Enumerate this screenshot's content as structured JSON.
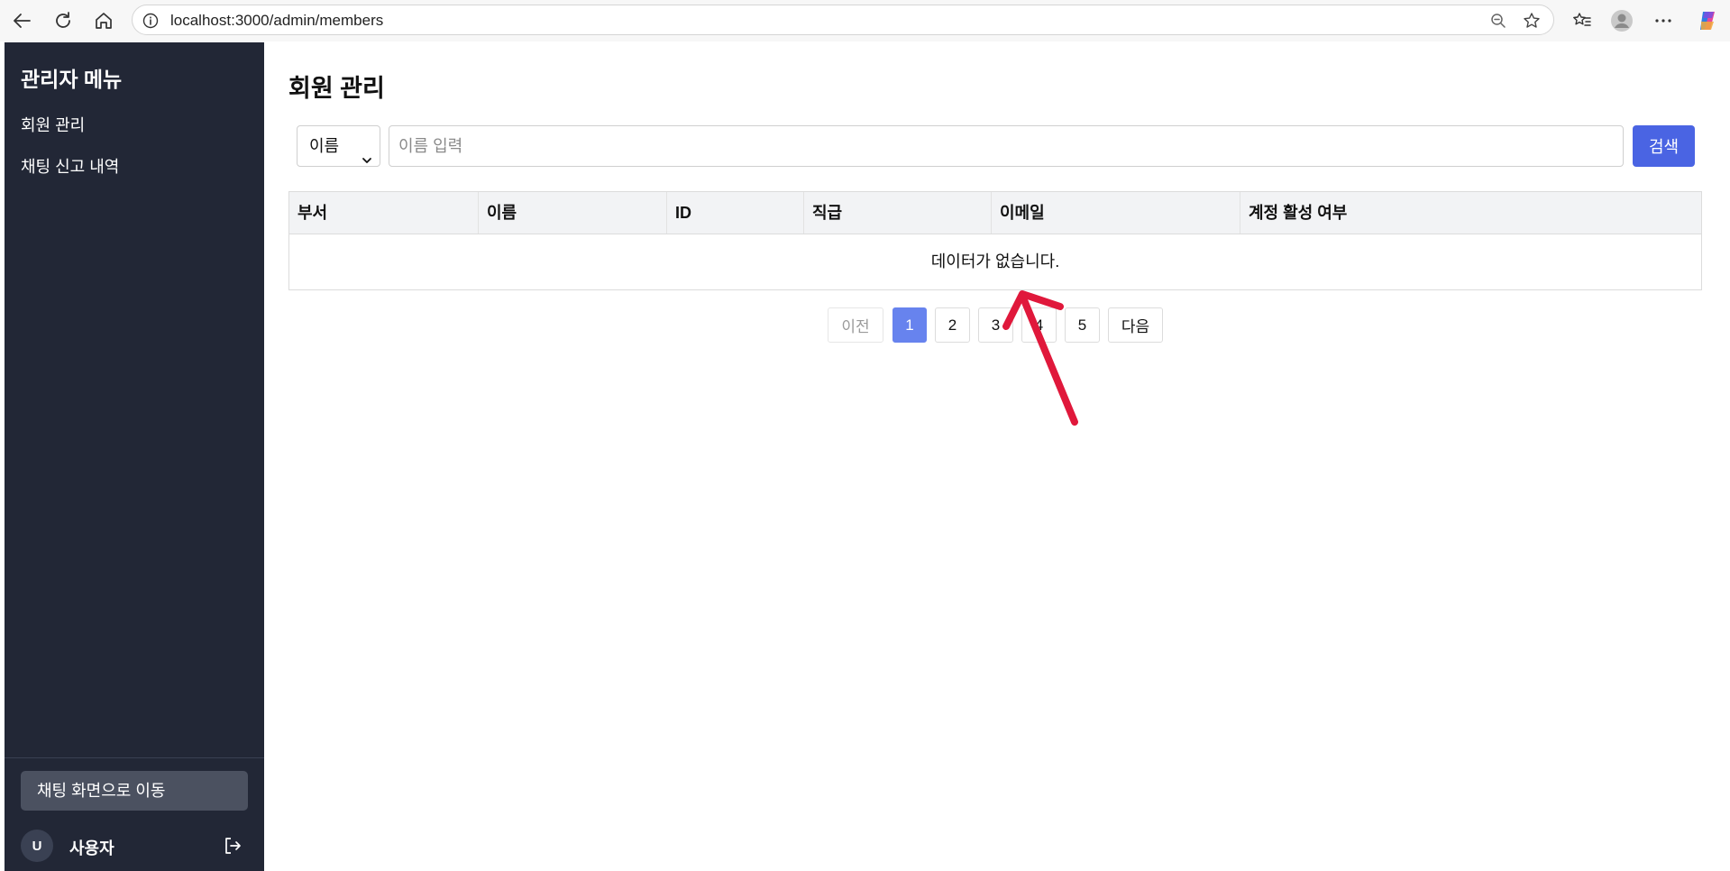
{
  "browser": {
    "url": "localhost:3000/admin/members"
  },
  "sidebar": {
    "title": "관리자 메뉴",
    "items": [
      {
        "label": "회원 관리"
      },
      {
        "label": "채팅 신고 내역"
      }
    ],
    "chat_button": "채팅 화면으로 이동",
    "avatar_initial": "U",
    "username": "사용자"
  },
  "main": {
    "title": "회원 관리",
    "search": {
      "field_select": "이름",
      "placeholder": "이름 입력",
      "value": "",
      "button": "검색"
    },
    "table": {
      "columns": [
        "부서",
        "이름",
        "ID",
        "직급",
        "이메일",
        "계정 활성 여부"
      ],
      "empty_message": "데이터가 없습니다."
    },
    "pagination": {
      "prev": "이전",
      "pages": [
        "1",
        "2",
        "3",
        "4",
        "5"
      ],
      "current": "1",
      "next": "다음"
    }
  },
  "colors": {
    "sidebar_bg": "#222736",
    "accent": "#4a64e3",
    "active_page": "#6783ee",
    "annotation_arrow": "#e0183b"
  }
}
